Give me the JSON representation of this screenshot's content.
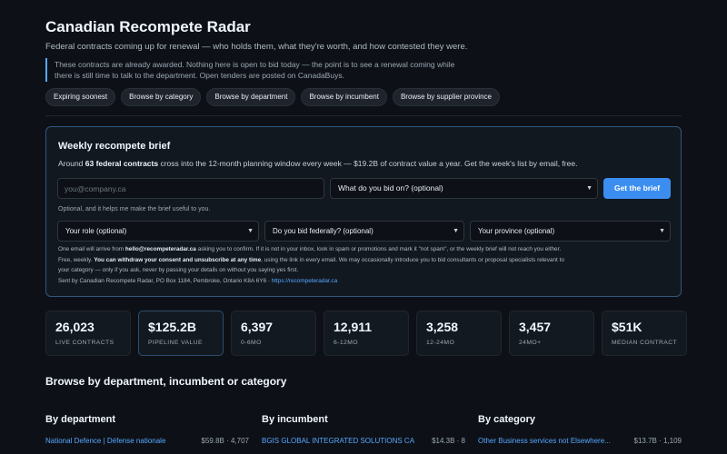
{
  "header": {
    "title": "Canadian Recompete Radar",
    "subtitle": "Federal contracts coming up for renewal — who holds them, what they're worth, and how contested they were.",
    "notice_line1": "These contracts are already awarded. Nothing here is open to bid today — the point is to see a renewal coming while",
    "notice_line2": "there is still time to talk to the department. Open tenders are posted on CanadaBuys."
  },
  "nav_chips": [
    "Expiring soonest",
    "Browse by category",
    "Browse by department",
    "Browse by incumbent",
    "Browse by supplier province"
  ],
  "brief": {
    "title": "Weekly recompete brief",
    "desc_prefix": "Around ",
    "desc_bold": "63 federal contracts",
    "desc_suffix": " cross into the 12-month planning window every week — $19.2B of contract value a year. Get the week's list by email, free.",
    "email_placeholder": "you@company.ca",
    "bid_select": "What do you bid on? (optional)",
    "button": "Get the brief",
    "optional_note": "Optional, and it helps me make the brief useful to you.",
    "role_select": "Your role (optional)",
    "federal_select": "Do you bid federally? (optional)",
    "province_select": "Your province (optional)",
    "fine_1a": "One email will arrive from ",
    "fine_1b": "hello@recompeteradar.ca",
    "fine_1c": " asking you to confirm. If it is not in your inbox, look in spam or promotions and mark it \"not spam\", or the weekly brief will not reach you either.",
    "fine_2a": "Free, weekly. ",
    "fine_2b": "You can withdraw your consent and unsubscribe at any time",
    "fine_2c": ", using the link in every email. We may occasionally introduce you to bid consultants or proposal specialists relevant to",
    "fine_3": "your category — only if you ask, never by passing your details on without you saying yes first.",
    "fine_4a": "Sent by Canadian Recompete Radar, PO Box 1184, Pembroke, Ontario K8A 6Y6 · ",
    "fine_4b": "https://recompeteradar.ca"
  },
  "stats": [
    {
      "value": "26,023",
      "label": "LIVE CONTRACTS"
    },
    {
      "value": "$125.2B",
      "label": "PIPELINE VALUE"
    },
    {
      "value": "6,397",
      "label": "0-6MO"
    },
    {
      "value": "12,911",
      "label": "6-12MO"
    },
    {
      "value": "3,258",
      "label": "12-24MO"
    },
    {
      "value": "3,457",
      "label": "24MO+"
    },
    {
      "value": "$51K",
      "label": "MEDIAN CONTRACT"
    }
  ],
  "browse": {
    "heading": "Browse by department, incumbent or category",
    "columns": [
      {
        "heading": "By department",
        "name": "National Defence | Défense nationale",
        "meta": "$59.8B · 4,707"
      },
      {
        "heading": "By incumbent",
        "name": "BGIS GLOBAL INTEGRATED SOLUTIONS CA",
        "meta": "$14.3B · 8"
      },
      {
        "heading": "By category",
        "name": "Other Business services not Elsewhere...",
        "meta": "$13.7B · 1,109"
      }
    ]
  },
  "colors": {
    "accent": "#3b8ef0",
    "link": "#58a6ff",
    "background": "#0d1117",
    "card": "#131920"
  },
  "icons": {
    "select_chevron": "chevron-down-icon"
  }
}
